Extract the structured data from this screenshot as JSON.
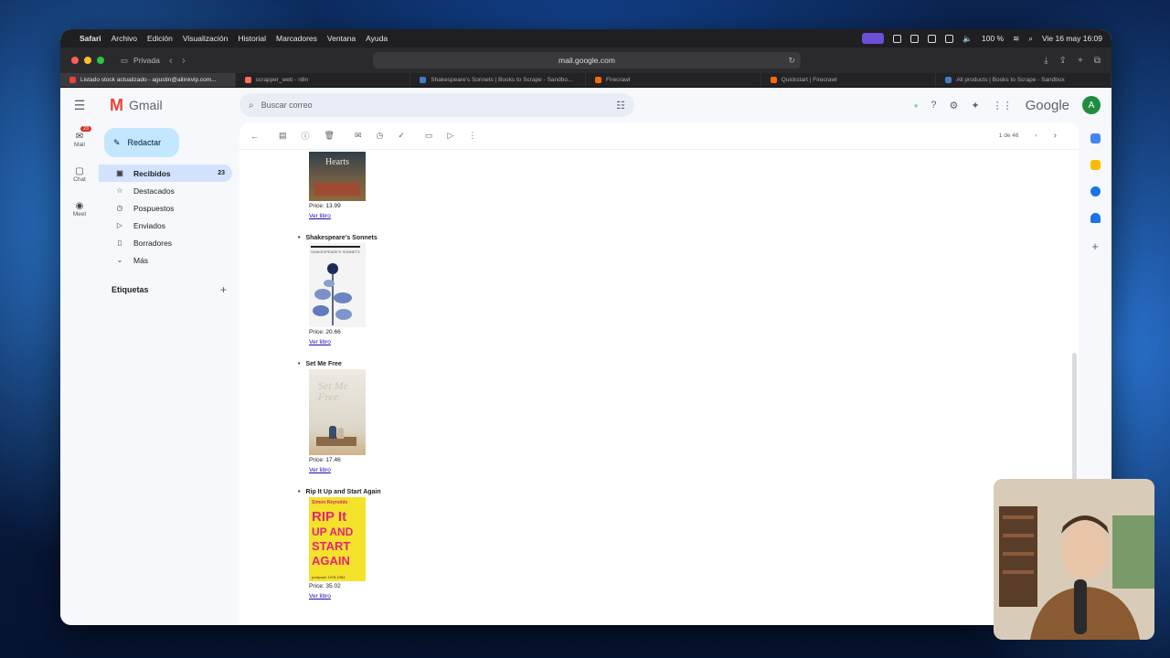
{
  "menubar": {
    "app": "Safari",
    "items": [
      "Archivo",
      "Edición",
      "Visualización",
      "Historial",
      "Marcadores",
      "Ventana",
      "Ayuda"
    ],
    "battery": "100 %",
    "datetime": "Vie 16 may 16:09"
  },
  "browser": {
    "private_label": "Privada",
    "url": "mail.google.com",
    "tabs": [
      {
        "label": "Listado stock actualizado - agustin@allinkvip.com...",
        "active": true,
        "color": "#ea4335"
      },
      {
        "label": "scrapper_web - n8n",
        "active": false,
        "color": "#ff6d5a"
      },
      {
        "label": "Shakespeare's Sonnets | Books to Scrape - Sandbo...",
        "active": false,
        "color": "#3f7fbf"
      },
      {
        "label": "Firecrawl",
        "active": false,
        "color": "#ff6a00"
      },
      {
        "label": "Quickstart | Firecrawl",
        "active": false,
        "color": "#ff6a00"
      },
      {
        "label": "All products | Books to Scrape - Sandbox",
        "active": false,
        "color": "#3f7fbf"
      }
    ]
  },
  "gmail": {
    "brand": "Gmail",
    "search_placeholder": "Buscar correo",
    "google_label": "Google",
    "avatar_letter": "A",
    "rail": [
      {
        "label": "Mail",
        "badge": "23"
      },
      {
        "label": "Chat"
      },
      {
        "label": "Meet"
      }
    ],
    "compose_label": "Redactar",
    "nav": [
      {
        "label": "Recibidos",
        "count": "23",
        "active": true,
        "icon": "inbox-icon"
      },
      {
        "label": "Destacados",
        "icon": "star-icon"
      },
      {
        "label": "Pospuestos",
        "icon": "clock-icon"
      },
      {
        "label": "Enviados",
        "icon": "send-icon"
      },
      {
        "label": "Borradores",
        "icon": "draft-icon"
      },
      {
        "label": "Más",
        "icon": "chevron-down-icon"
      }
    ],
    "labels_title": "Etiquetas",
    "pager_text": "1 de 46"
  },
  "email": {
    "books": [
      {
        "title": "",
        "price": "Price: 13.99",
        "link": "Ver libro",
        "cover_color": "#5b4a3a"
      },
      {
        "title": "Shakespeare's Sonnets",
        "price": "Price: 20.66",
        "link": "Ver libro",
        "cover_color": "#f3f3f3"
      },
      {
        "title": "Set Me Free",
        "price": "Price: 17.46",
        "link": "Ver libro",
        "cover_color": "#e8e1d3"
      },
      {
        "title": "Rip It Up and Start Again",
        "price": "Price: 35.02",
        "link": "Ver libro",
        "cover_color": "#f5e22b"
      }
    ],
    "first_cover_text": "Hearts",
    "sonnets_cover_text": "SHAKESPEARE'S SONNETS",
    "setmefree_cover_text": "Set Me Free",
    "rip_cover_text": [
      "RIP It",
      "UP AND",
      "START",
      "AGAIN"
    ],
    "rip_cover_author": "Simon Reynolds",
    "rip_cover_sub": "postpunk 1978-1984"
  }
}
